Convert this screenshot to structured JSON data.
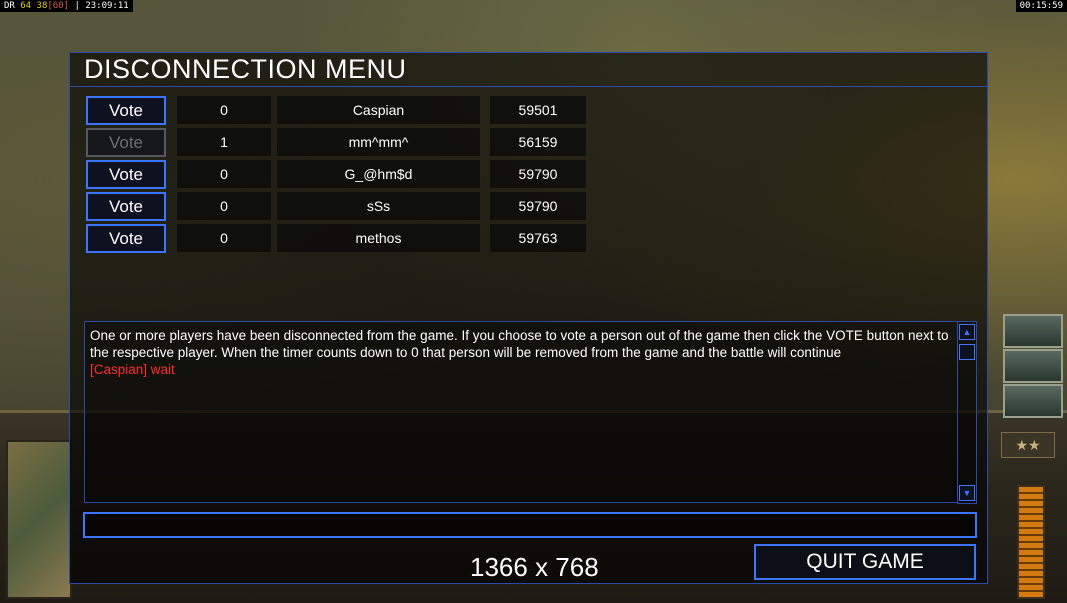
{
  "hud": {
    "top_left_prefix": "DR",
    "top_left_a": "64",
    "top_left_b": "38",
    "top_left_c": "[60]",
    "top_left_time": "23:09:11",
    "top_right_time": "00:15:59"
  },
  "dialog": {
    "title": "DISCONNECTION MENU",
    "players": [
      {
        "vote_label": "Vote",
        "vote_enabled": true,
        "count": "0",
        "name": "Caspian",
        "ping": "59501"
      },
      {
        "vote_label": "Vote",
        "vote_enabled": false,
        "count": "1",
        "name": "mm^mm^",
        "ping": "56159"
      },
      {
        "vote_label": "Vote",
        "vote_enabled": true,
        "count": "0",
        "name": "G_@hm$d",
        "ping": "59790"
      },
      {
        "vote_label": "Vote",
        "vote_enabled": true,
        "count": "0",
        "name": "sSs",
        "ping": "59790"
      },
      {
        "vote_label": "Vote",
        "vote_enabled": true,
        "count": "0",
        "name": "methos",
        "ping": "59763"
      }
    ],
    "message": "One or more players have been disconnected from the game. If you choose to vote a person out of the game then click the VOTE button next to the respective player. When the timer counts down to 0 that person will be removed from the game and the battle will continue",
    "chat_line": "[Caspian] wait",
    "chat_input_value": "",
    "quit_label": "QUIT GAME"
  },
  "resolution_text": "1366 x 768",
  "colors": {
    "accent_blue": "#3b74ff",
    "chat_red": "#ff2a2a",
    "disabled_gray": "#6b6f76"
  }
}
